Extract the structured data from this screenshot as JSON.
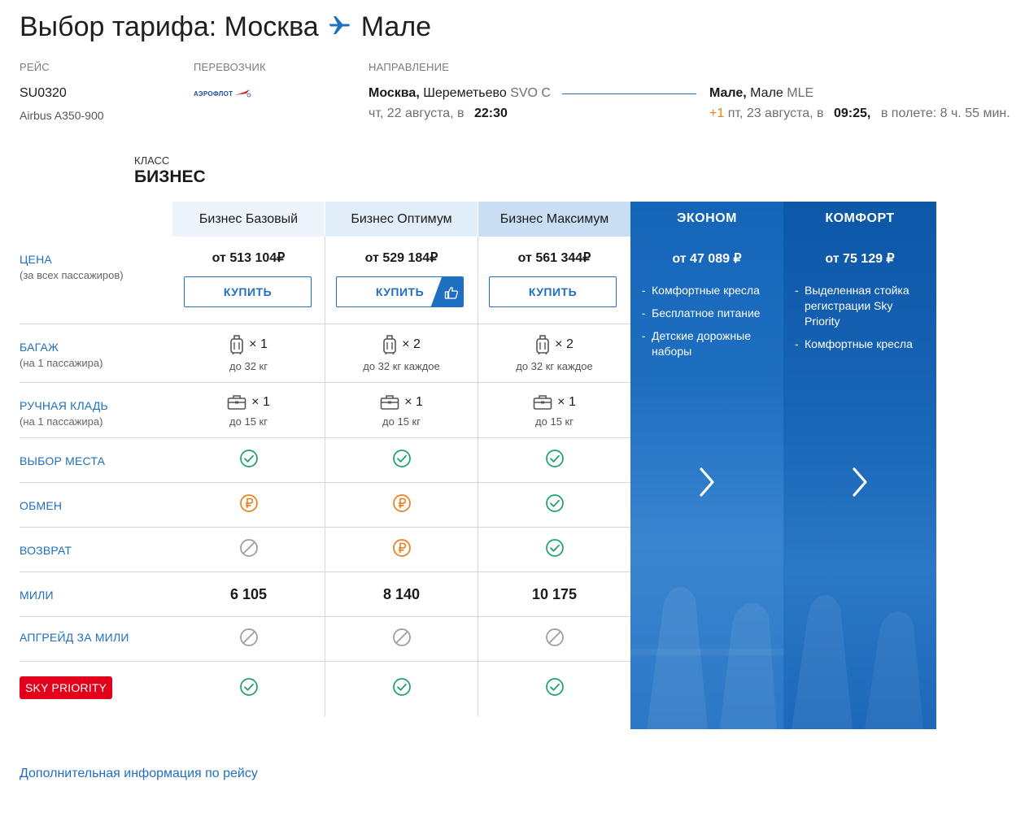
{
  "header": {
    "title_prefix": "Выбор тарифа: Москва",
    "title_destination": "Мале"
  },
  "flight": {
    "label": "РЕЙС",
    "number": "SU0320",
    "aircraft": "Airbus A350-900"
  },
  "carrier": {
    "label": "ПЕРЕВОЗЧИК",
    "logo_text": "АЭРОФЛОТ"
  },
  "route": {
    "label": "НАПРАВЛЕНИЕ",
    "from_city": "Москва,",
    "from_airport": "Шереметьево",
    "from_code": "SVO C",
    "from_date": "чт, 22 августа, в",
    "from_time": "22:30",
    "to_city": "Мале,",
    "to_airport": "Мале",
    "to_code": "MLE",
    "day_shift": "+1",
    "to_date": "пт, 23 августа, в",
    "to_time": "09:25,",
    "duration": "в полете: 8 ч. 55 мин."
  },
  "class_section": {
    "label": "КЛАСС",
    "name": "БИЗНЕС"
  },
  "rows": {
    "price": {
      "label": "ЦЕНА",
      "sub": "(за всех пассажиров)"
    },
    "baggage": {
      "label": "БАГАЖ",
      "sub": "(на 1 пассажира)"
    },
    "carryon": {
      "label": "РУЧНАЯ КЛАДЬ",
      "sub": "(на 1 пассажира)"
    },
    "seat": {
      "label": "ВЫБОР МЕСТА"
    },
    "exchange": {
      "label": "ОБМЕН"
    },
    "refund": {
      "label": "ВОЗВРАТ"
    },
    "miles": {
      "label": "МИЛИ"
    },
    "upgrade": {
      "label": "АПГРЕЙД ЗА МИЛИ"
    },
    "sky_priority": {
      "label": "SKY PRIORITY"
    }
  },
  "buy_label": "КУПИТЬ",
  "tariffs": [
    {
      "name": "Бизнес Базовый",
      "price": "от 513 104₽",
      "recommended": false,
      "baggage_count": "× 1",
      "baggage_note": "до 32 кг",
      "carryon_count": "× 1",
      "carryon_note": "до 15 кг",
      "seat": "included",
      "exchange": "paid",
      "refund": "unavailable",
      "miles": "6 105",
      "upgrade": "unavailable",
      "sky_priority": "included"
    },
    {
      "name": "Бизнес Оптимум",
      "price": "от 529 184₽",
      "recommended": true,
      "baggage_count": "× 2",
      "baggage_note": "до 32 кг каждое",
      "carryon_count": "× 1",
      "carryon_note": "до 15 кг",
      "seat": "included",
      "exchange": "paid",
      "refund": "paid",
      "miles": "8 140",
      "upgrade": "unavailable",
      "sky_priority": "included"
    },
    {
      "name": "Бизнес Максимум",
      "price": "от 561 344₽",
      "recommended": false,
      "baggage_count": "× 2",
      "baggage_note": "до 32 кг каждое",
      "carryon_count": "× 1",
      "carryon_note": "до 15 кг",
      "seat": "included",
      "exchange": "included",
      "refund": "included",
      "miles": "10 175",
      "upgrade": "unavailable",
      "sky_priority": "included"
    }
  ],
  "other_classes": [
    {
      "name": "ЭКОНОМ",
      "price": "от 47 089 ₽",
      "features": [
        "Комфортные кресла",
        "Бесплатное питание",
        "Детские дорожные наборы"
      ]
    },
    {
      "name": "КОМФОРТ",
      "price": "от 75 129 ₽",
      "features": [
        "Выделенная стойка регистрации Sky Priority",
        "Комфортные кресла"
      ]
    }
  ],
  "more_info_link": "Дополнительная информация по рейсу",
  "colors": {
    "accent": "#1f6fc1",
    "check": "#1aa06d",
    "paid": "#ef7d1a",
    "unavailable": "#9a9a9a",
    "sky_priority": "#e3001b",
    "header_basic": "#edf4fb",
    "header_optimum": "#e1edf8",
    "header_maximum": "#c9def3"
  }
}
